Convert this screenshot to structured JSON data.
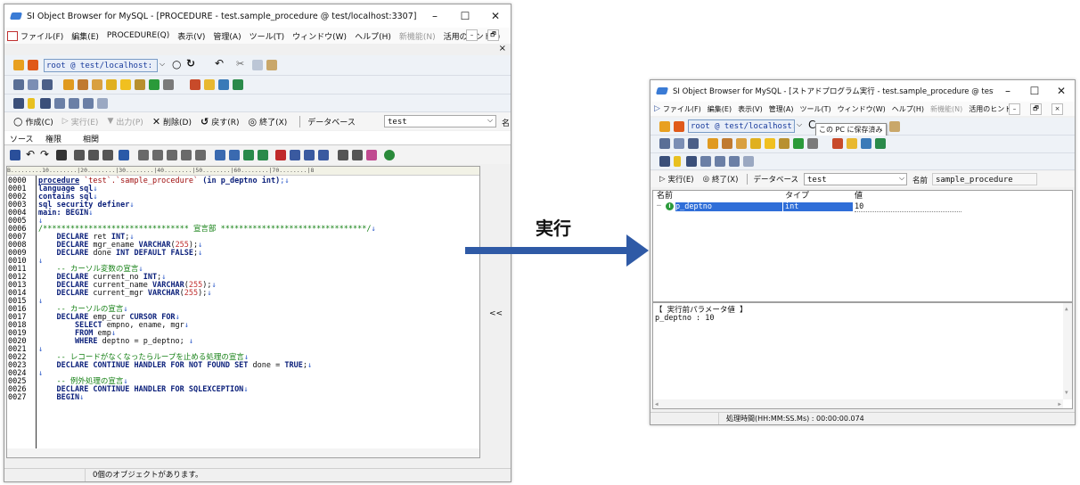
{
  "left_window": {
    "title": "SI Object Browser for MySQL - [PROCEDURE - test.sample_procedure @ test/localhost:3307]",
    "window_buttons": {
      "minimize": "–",
      "maximize": "☐",
      "close": "✕"
    },
    "menu": [
      "ファイル(F)",
      "編集(E)",
      "PROCEDURE(Q)",
      "表示(V)",
      "管理(A)",
      "ツール(T)",
      "ウィンドウ(W)",
      "ヘルプ(H)",
      "新機能(N)",
      "活用のヒント(I)"
    ],
    "mdi_buttons": {
      "restore": "–",
      "maximize": "🗗",
      "close": "×"
    },
    "connection": "root @ test/localhost:",
    "commands": [
      {
        "label": "作成(C)",
        "enabled": true
      },
      {
        "label": "実行(E)",
        "enabled": false
      },
      {
        "label": "出力(P)",
        "enabled": false
      },
      {
        "label": "削除(D)",
        "enabled": true
      },
      {
        "label": "戻す(R)",
        "enabled": true
      },
      {
        "label": "終了(X)",
        "enabled": true
      }
    ],
    "database_label": "データベース",
    "database_value": "test",
    "name_label": "名",
    "tabs": [
      "ソース",
      "権限",
      "相関"
    ],
    "ruler": "B.........10........|20........|30........|40........|50........|60........|70........|8",
    "line_numbers": [
      "0000",
      "0001",
      "0002",
      "0003",
      "0004",
      "0005",
      "0006",
      "0007",
      "0008",
      "0009",
      "0010",
      "0011",
      "0012",
      "0013",
      "0014",
      "0015",
      "0016",
      "0017",
      "0018",
      "0019",
      "0020",
      "0021",
      "0022",
      "0023",
      "0024",
      "0025",
      "0026",
      "0027"
    ],
    "collapse_button": "<<",
    "status": "0個のオブジェクトがあります。"
  },
  "arrow_label": "実行",
  "right_window": {
    "title": "SI Object Browser for MySQL - [ストアドプログラム実行 - test.sample_procedure @ test/localh...",
    "window_buttons": {
      "minimize": "–",
      "maximize": "☐",
      "close": "✕"
    },
    "menu": [
      "ファイル(F)",
      "編集(E)",
      "表示(V)",
      "管理(A)",
      "ツール(T)",
      "ウィンドウ(W)",
      "ヘルプ(H)",
      "新機能(N)",
      "活用のヒント(I)"
    ],
    "mdi_buttons": {
      "restore": "–",
      "maximize": "🗗",
      "close": "×"
    },
    "connection": "root @ test/localhost:",
    "tooltip": "この PC に保存済み",
    "commands": [
      {
        "label": "実行(E)",
        "enabled": true
      },
      {
        "label": "終了(X)",
        "enabled": true
      }
    ],
    "database_label": "データベース",
    "database_value": "test",
    "name_label": "名前",
    "name_value": "sample_procedure",
    "grid_headers": [
      "名前",
      "タイプ",
      "値"
    ],
    "params": [
      {
        "name": "p_deptno",
        "type": "int",
        "value": "10"
      }
    ],
    "output_lines": [
      "【 実行前パラメータ値 】",
      "p_deptno : 10"
    ],
    "status": "処理時間(HH:MM:SS.Ms) : 00:00:00.074"
  }
}
